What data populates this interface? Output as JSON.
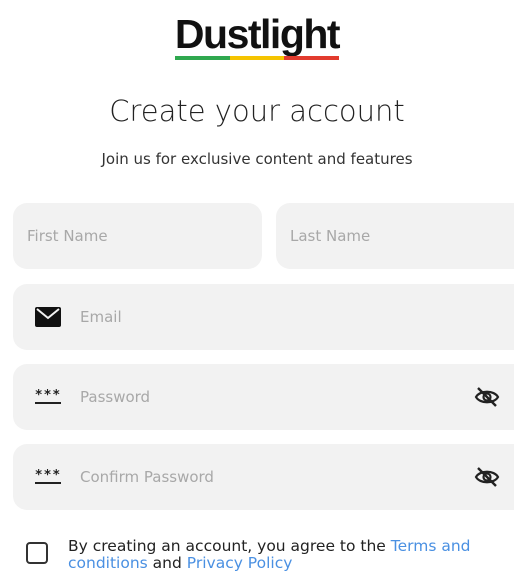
{
  "brand": {
    "name": "Dustlight",
    "stripe_colors": [
      "#2fa84f",
      "#f5c400",
      "#e23b2e"
    ]
  },
  "header": {
    "title": "Create your account",
    "subtitle": "Join us for exclusive content and features"
  },
  "form": {
    "first_name": {
      "placeholder": "First Name",
      "value": ""
    },
    "last_name": {
      "placeholder": "Last Name",
      "value": ""
    },
    "email": {
      "placeholder": "Email",
      "value": "",
      "icon": "envelope-icon"
    },
    "password": {
      "placeholder": "Password",
      "value": "",
      "icon": "password-stars-icon",
      "toggle_icon": "eye-off-icon"
    },
    "confirm_password": {
      "placeholder": "Confirm Password",
      "value": "",
      "icon": "password-stars-icon",
      "toggle_icon": "eye-off-icon"
    },
    "password_mask": "***"
  },
  "agreement": {
    "checked": false,
    "text_before": "By creating an account, you agree to the ",
    "terms_link": "Terms and conditions",
    "text_middle": " and ",
    "privacy_link": "Privacy Policy"
  },
  "colors": {
    "field_bg": "#f2f2f2",
    "link": "#4a90e2",
    "placeholder": "#a8a8a8"
  }
}
